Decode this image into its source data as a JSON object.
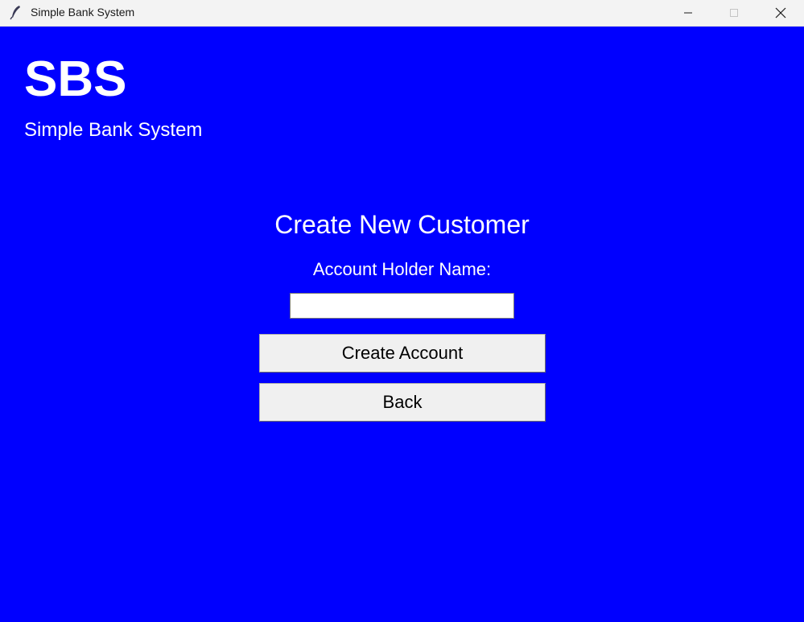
{
  "window": {
    "title": "Simple Bank System",
    "controls": {
      "minimize": "minimize-icon",
      "maximize": "maximize-icon",
      "close": "close-icon"
    }
  },
  "header": {
    "logo": "SBS",
    "subtitle": "Simple Bank System"
  },
  "form": {
    "title": "Create New Customer",
    "name_label": "Account Holder Name:",
    "name_value": "",
    "create_button": "Create Account",
    "back_button": "Back"
  },
  "colors": {
    "background": "#0000ff",
    "text": "#ffffff",
    "button": "#f0f0f0"
  }
}
